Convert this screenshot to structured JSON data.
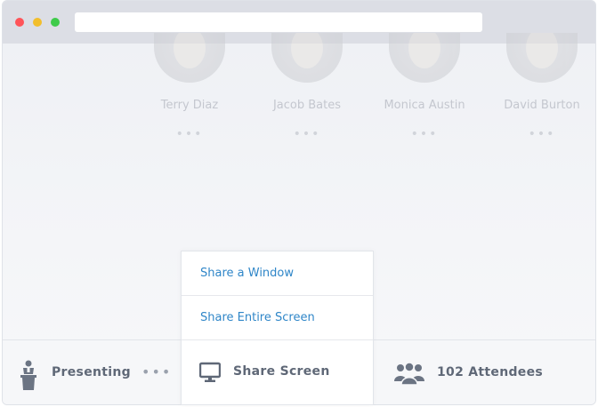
{
  "participants": [
    {
      "name": "Terry Diaz",
      "menu": "•••"
    },
    {
      "name": "Jacob Bates",
      "menu": "•••"
    },
    {
      "name": "Monica Austin",
      "menu": "•••"
    },
    {
      "name": "David Burton",
      "menu": "•••"
    }
  ],
  "toolbar": {
    "presenting_label": "Presenting",
    "more_label": "•••",
    "share_screen_label": "Share Screen",
    "attendees_label": "102 Attendees"
  },
  "share_menu": {
    "items": [
      "Share a Window",
      "Share Entire Screen"
    ]
  },
  "colors": {
    "accent_link": "#2f86c8",
    "toolbar_text": "#5f6877",
    "close_dot": "#ff5459",
    "minimize_dot": "#f2be2c",
    "maximize_dot": "#3ecb4a"
  },
  "icons": {
    "presenting": "podium-person-icon",
    "share_screen": "monitor-icon",
    "attendees": "people-group-icon"
  }
}
